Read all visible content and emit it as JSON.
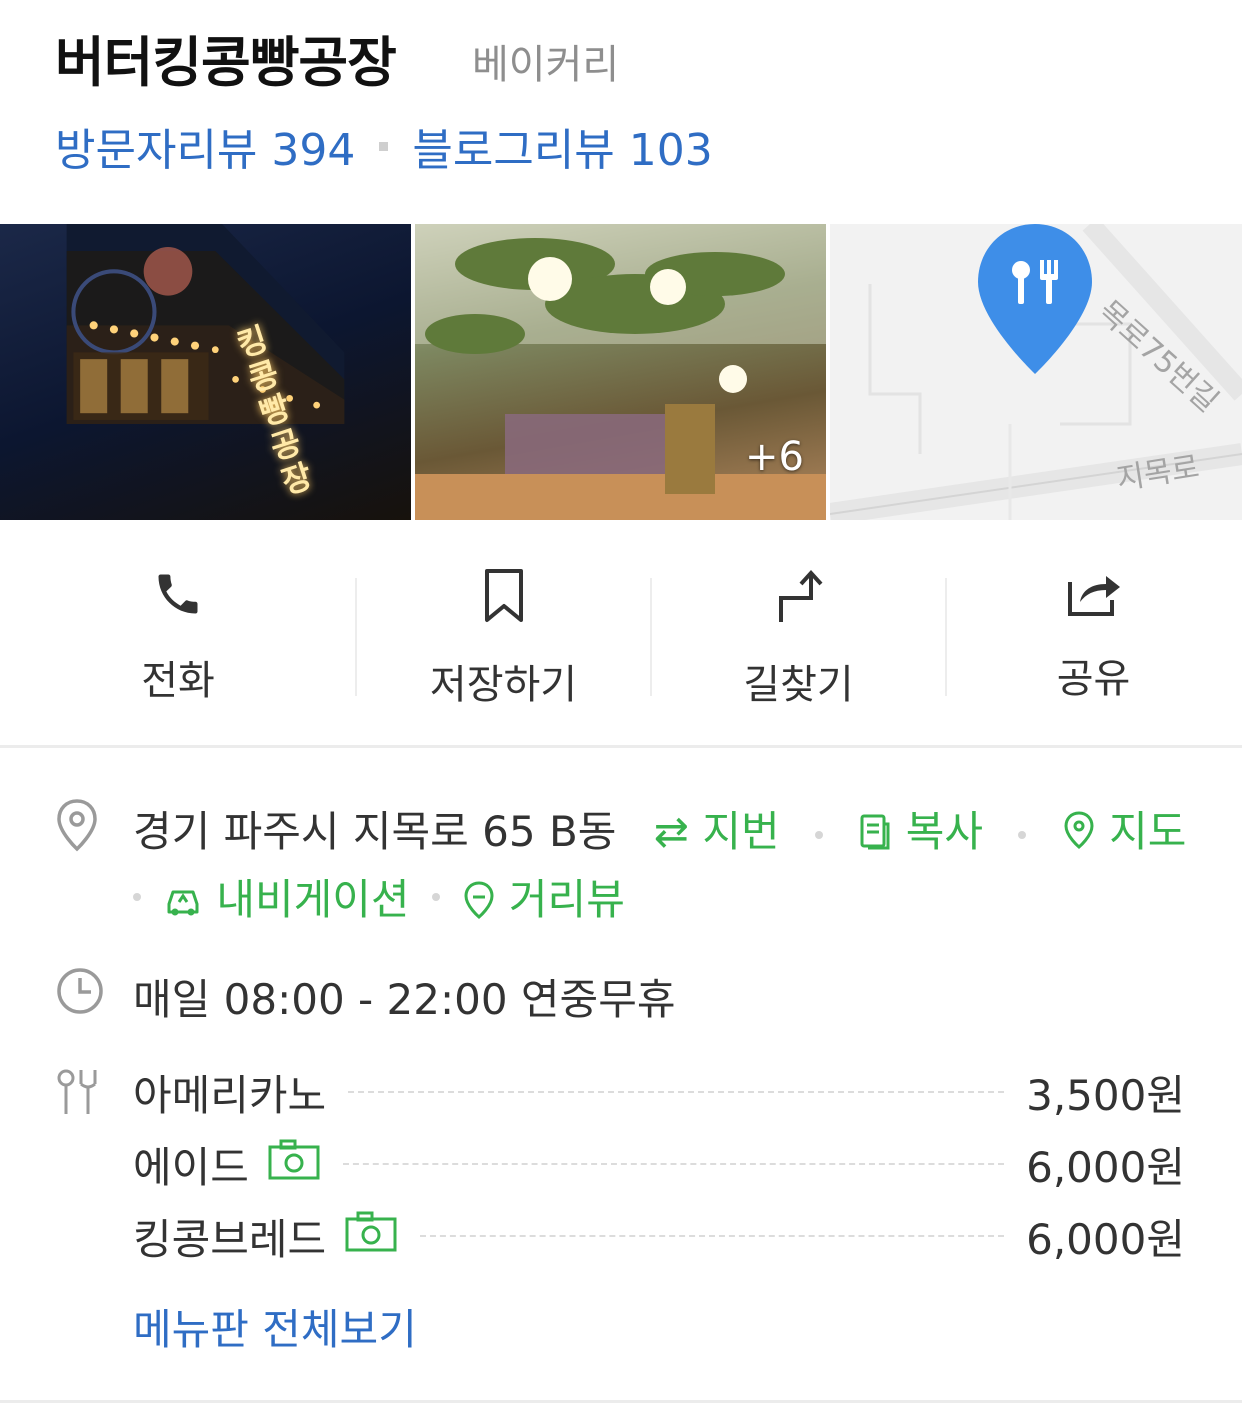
{
  "place": {
    "name": "버터킹콩빵공장",
    "category": "베이커리",
    "visitor_reviews": "방문자리뷰 394",
    "blog_reviews": "블로그리뷰 103"
  },
  "photos": {
    "storefront_sign": "킹콩빵공장",
    "more_count": "+6",
    "map_road_1": "목로75번길",
    "map_road_2": "지목로"
  },
  "actions": [
    {
      "label": "전화",
      "icon": "phone-icon"
    },
    {
      "label": "저장하기",
      "icon": "bookmark-icon"
    },
    {
      "label": "길찾기",
      "icon": "directions-icon"
    },
    {
      "label": "공유",
      "icon": "share-icon"
    }
  ],
  "address": {
    "text": "경기 파주시 지목로 65 B동",
    "lot_number": "지번",
    "copy": "복사",
    "map": "지도",
    "navigation": "내비게이션",
    "street_view": "거리뷰"
  },
  "hours": {
    "text": "매일 08:00 - 22:00 연중무휴"
  },
  "menu": {
    "items": [
      {
        "name": "아메리카노",
        "price": "3,500원",
        "has_photo": false
      },
      {
        "name": "에이드",
        "price": "6,000원",
        "has_photo": true
      },
      {
        "name": "킹콩브레드",
        "price": "6,000원",
        "has_photo": true
      }
    ],
    "view_all": "메뉴판 전체보기"
  },
  "colors": {
    "link_blue": "#2f6dc4",
    "action_green": "#37b24d",
    "map_pin_blue": "#3e8ee8"
  }
}
